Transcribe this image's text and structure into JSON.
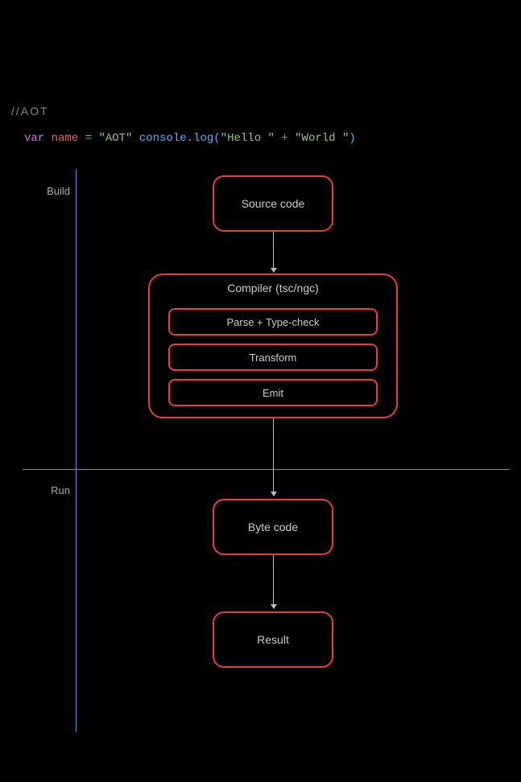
{
  "section_tag": "//AOT",
  "code": {
    "keyword": "var",
    "identifier": "name",
    "operator": "=",
    "string": "\"AOT\"",
    "call_open": "console.log(",
    "msg1": "\"Hello \"",
    "plus": " + ",
    "msg2": "\"World \"",
    "call_close": ")"
  },
  "stage_labels": {
    "build": "Build",
    "run": "Run"
  },
  "diagram": {
    "source": "Source code",
    "compiler_title": "Compiler (tsc/ngc)",
    "passes": [
      "Parse + Type-check",
      "Transform",
      "Emit"
    ],
    "bytecode": "Byte code",
    "result": "Result"
  }
}
